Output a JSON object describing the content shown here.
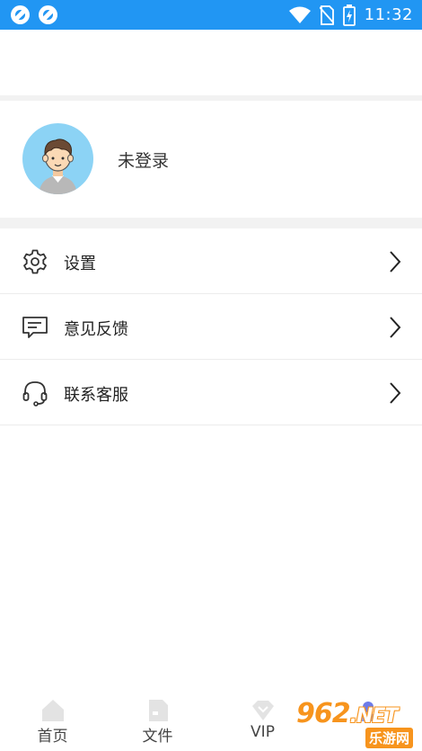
{
  "status_bar": {
    "time": "11:32",
    "icons": [
      "app-icon",
      "app-icon",
      "wifi-icon",
      "no-sim-icon",
      "battery-charging-icon"
    ]
  },
  "profile": {
    "name": "未登录",
    "avatar_icon": "user-avatar-icon"
  },
  "menu": {
    "items": [
      {
        "label": "设置",
        "icon": "gear-icon"
      },
      {
        "label": "意见反馈",
        "icon": "feedback-icon"
      },
      {
        "label": "联系客服",
        "icon": "headset-icon"
      }
    ]
  },
  "bottom_nav": {
    "items": [
      {
        "label": "首页",
        "icon": "home-icon"
      },
      {
        "label": "文件",
        "icon": "file-icon"
      },
      {
        "label": "VIP",
        "icon": "vip-icon"
      },
      {
        "label": "",
        "icon": "profile-icon"
      }
    ]
  },
  "watermark": {
    "main": "962",
    "suffix": ".NET",
    "sub": "乐游网"
  },
  "colors": {
    "status_bar": "#2196f3",
    "avatar_bg": "#8cd3f5",
    "divider": "#f2f2f2",
    "watermark": "#f7941d"
  }
}
